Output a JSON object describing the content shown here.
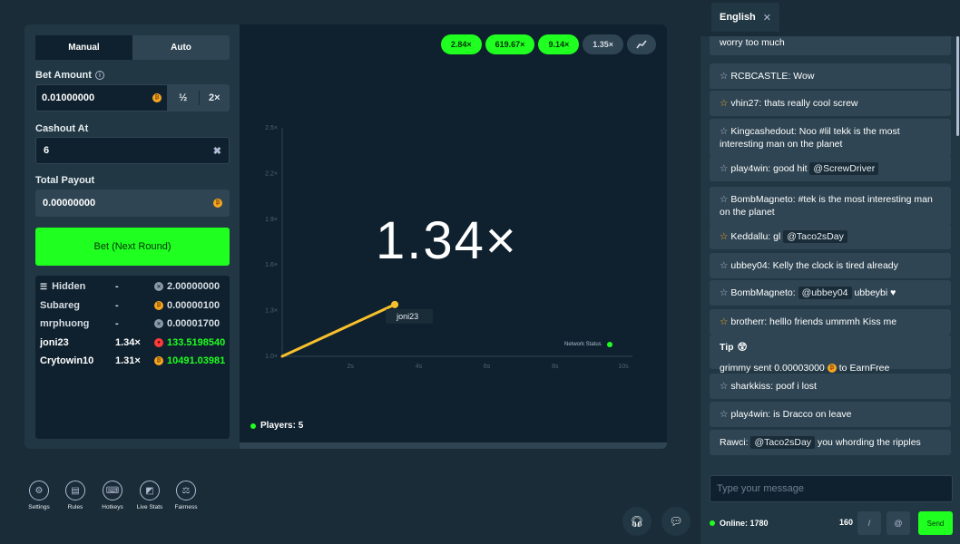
{
  "game": {
    "tabs": [
      "Manual",
      "Auto"
    ],
    "bet_amount_label": "Bet Amount",
    "bet_amount_value": "0.01000000",
    "half_label": "½",
    "double_label": "2×",
    "cashout_label": "Cashout At",
    "cashout_value": "6",
    "payout_label": "Total Payout",
    "payout_value": "0.00000000",
    "bet_button": "Bet (Next Round)",
    "players": [
      {
        "name": "Hidden",
        "mult": "-",
        "amount": "2.00000000",
        "coin": "grey",
        "win": false
      },
      {
        "name": "Subareg",
        "mult": "-",
        "amount": "0.00000100",
        "coin": "gold",
        "win": false
      },
      {
        "name": "mrphuong",
        "mult": "-",
        "amount": "0.00001700",
        "coin": "grey",
        "win": false
      },
      {
        "name": "joni23",
        "mult": "1.34×",
        "amount": "133.5198540",
        "coin": "red",
        "win": true
      },
      {
        "name": "Crytowin10",
        "mult": "1.31×",
        "amount": "10491.03981",
        "coin": "gold",
        "win": true
      }
    ]
  },
  "history": [
    "2.84×",
    "619.67×",
    "9.14×",
    "1.35×"
  ],
  "chart_data": {
    "type": "line",
    "multiplier_display": "1.34×",
    "y_ticks": [
      "2.5×",
      "2.2×",
      "1.9×",
      "1.6×",
      "1.3×",
      "1.0×"
    ],
    "x_ticks": [
      "2s",
      "4s",
      "6s",
      "8s",
      "10s"
    ],
    "ylim": [
      1.0,
      2.5
    ],
    "xlim": [
      0,
      10
    ],
    "series": [
      {
        "points": [
          [
            0,
            1.0
          ],
          [
            3.3,
            1.34
          ]
        ]
      }
    ],
    "markers": [
      {
        "label": "joni23",
        "x": 3.3,
        "y": 1.34
      }
    ],
    "line_color": "#f7c02c"
  },
  "network_status": "Network Status",
  "players_count": "Players: 5",
  "toolbar": [
    "Settings",
    "Rules",
    "Hotkeys",
    "Live Stats",
    "Fairness"
  ],
  "chat": {
    "language": "English",
    "messages": [
      {
        "text": "worry too much"
      },
      {
        "user": "RCBCASTLE",
        "text": "Wow",
        "star": "grey"
      },
      {
        "user": "vhin27",
        "text": "thats really cool screw",
        "star": "gold"
      },
      {
        "user": "Kingcashedout",
        "text": "Noo #lil tekk is the most interesting man on the planet",
        "star": "grey"
      },
      {
        "user": "play4win",
        "text": "good hit",
        "mention": "@ScrewDriver",
        "star": "grey"
      },
      {
        "user": "BombMagneto",
        "text": "#tek is the most interesting man on the planet",
        "star": "grey"
      },
      {
        "user": "Keddallu",
        "text": "gl",
        "mention": "@Taco2sDay",
        "star": "gold"
      },
      {
        "user": "ubbey04",
        "text": "Kelly the clock is tired already",
        "star": "grey"
      },
      {
        "user": "BombMagneto",
        "text": "ubbeybi ♥",
        "mention": "@ubbey04",
        "star": "grey"
      },
      {
        "user": "brotherr",
        "text": "helllo friends ummmh Kiss me",
        "star": "gold"
      },
      {
        "user": "sharkkiss",
        "text": "poof i lost",
        "star": "grey"
      },
      {
        "user": "play4win",
        "text": "is Dracco on leave",
        "star": "grey"
      },
      {
        "user": "Rawci",
        "text": "you whording the ripples",
        "mention": "@Taco2sDay"
      }
    ],
    "tip": {
      "title": "Tip",
      "sender": "grimmy",
      "verb": "sent",
      "amount": "0.00003000",
      "to": "to",
      "recipient": "EarnFree"
    },
    "input_placeholder": "Type your message",
    "online": "Online: 1780",
    "char_count": "160",
    "slash": "/",
    "at": "@",
    "send": "Send"
  },
  "colors": {
    "accent": "#1fff20",
    "bg": "#1a2c38",
    "panel": "#213743",
    "dark": "#0f212e"
  }
}
